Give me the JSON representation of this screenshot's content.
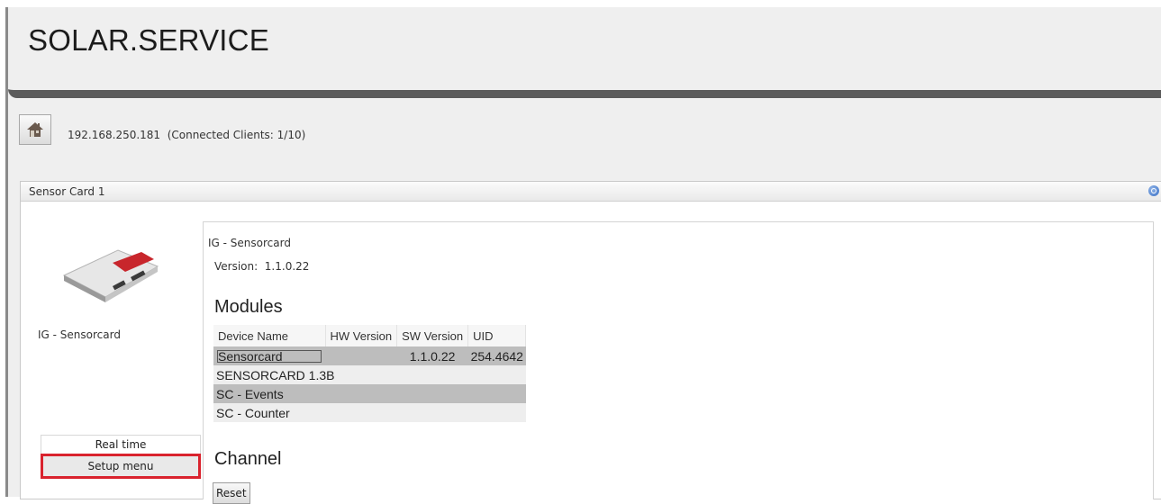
{
  "app": {
    "title": "SOLAR.SERVICE"
  },
  "connection": {
    "address_text": "192.168.250.181  (Connected Clients: 1/10)"
  },
  "panel": {
    "title": "Sensor Card 1",
    "device_label": "IG - Sensorcard",
    "tabs": [
      {
        "label": "Real time",
        "selected": false
      },
      {
        "label": "Setup menu",
        "selected": true
      }
    ],
    "product_name": "IG - Sensorcard",
    "version_line": "Version:  1.1.0.22",
    "modules": {
      "heading": "Modules",
      "columns": [
        "Device Name",
        "HW Version",
        "SW Version",
        "UID"
      ],
      "rows": [
        [
          "Sensorcard",
          "",
          "1.1.0.22",
          "254.4642"
        ],
        [
          "SENSORCARD 1.3B",
          "",
          "",
          ""
        ],
        [
          "SC - Events",
          "",
          "",
          ""
        ],
        [
          "SC - Counter",
          "",
          "",
          ""
        ]
      ]
    },
    "channel": {
      "heading": "Channel",
      "reset_label": "Reset"
    }
  },
  "colors": {
    "header_border": "#5b5b5b",
    "highlight": "#d9232e",
    "row_dark": "#bdbdbd"
  },
  "icons": {
    "home": "home-icon",
    "collapse": "collapse-icon"
  }
}
